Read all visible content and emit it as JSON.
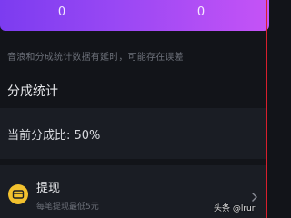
{
  "stats": [
    {
      "label": "",
      "value": "0"
    },
    {
      "label": "",
      "value": "0"
    }
  ],
  "notice": "音浪和分成统计数据有延时，可能存在误差",
  "section_title": "分成统计",
  "ratio_text": "当前分成比: 50%",
  "withdraw": {
    "title": "提现",
    "subtitle": "每笔提现最低5元"
  },
  "watermark": "头条 @lrur",
  "icons": {
    "wallet": "wallet-icon",
    "chevron": "chevron-right-icon"
  },
  "colors": {
    "gradient_start": "#7c3cf0",
    "gradient_end": "#c553f6",
    "wallet_icon": "#f2c12e",
    "divider_red": "#d81f2d"
  }
}
